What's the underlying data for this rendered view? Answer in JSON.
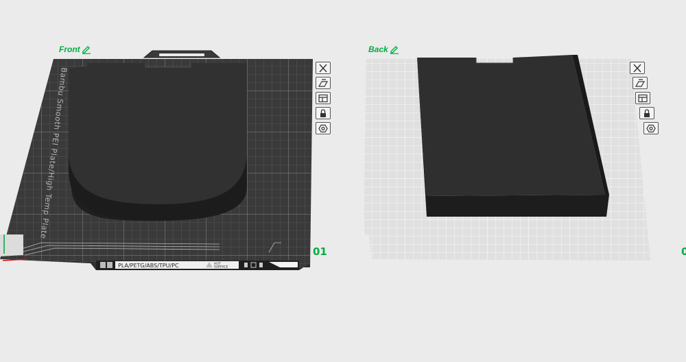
{
  "plates": [
    {
      "label": "Front",
      "number": "01",
      "bed_text": "Bambu Smooth PEI Plate/High Temp Plate",
      "filament_text": "PLA/PETG/ABS/TPU/PC",
      "hot_line1": "HOT",
      "hot_line2": "SURFACE"
    },
    {
      "label": "Back",
      "number": "0"
    }
  ],
  "toolbar_icons": [
    "close-icon",
    "auto-orient-icon",
    "arrange-icon",
    "lock-icon",
    "settings-icon"
  ],
  "colors": {
    "accent": "#00ae42",
    "bed_dark": "#3a3a3a",
    "bed_light": "#e3e3e3",
    "model": "#2e2e2e"
  }
}
